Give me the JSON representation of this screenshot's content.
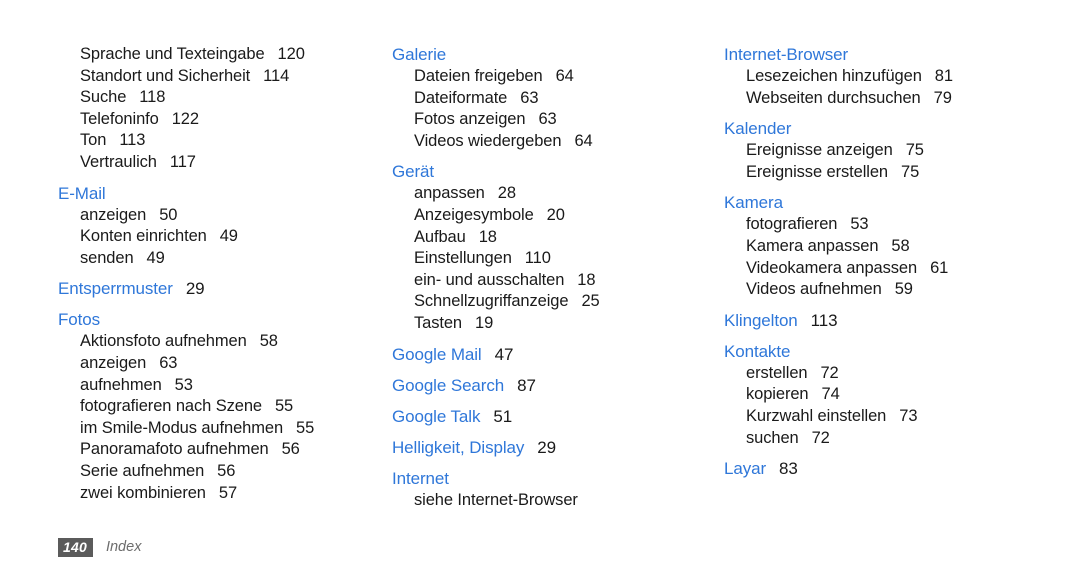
{
  "document": {
    "footer": {
      "page_number": "140",
      "label": "Index"
    },
    "heading_color": "#2F77D9",
    "text_color": "#1A1A1A",
    "badge_color": "#5B5B5B"
  },
  "columns": [
    {
      "id": "column-1",
      "sections": [
        {
          "heading": null,
          "heading_page": null,
          "entries": [
            {
              "label": "Sprache und Texteingabe",
              "page": "120"
            },
            {
              "label": "Standort und Sicherheit",
              "page": "114"
            },
            {
              "label": "Suche",
              "page": "118"
            },
            {
              "label": "Telefoninfo",
              "page": "122"
            },
            {
              "label": "Ton",
              "page": "113"
            },
            {
              "label": "Vertraulich",
              "page": "117"
            }
          ]
        },
        {
          "heading": "E-Mail",
          "heading_page": null,
          "entries": [
            {
              "label": "anzeigen",
              "page": "50"
            },
            {
              "label": "Konten einrichten",
              "page": "49"
            },
            {
              "label": "senden",
              "page": "49"
            }
          ]
        },
        {
          "heading": "Entsperrmuster",
          "heading_page": "29",
          "entries": []
        },
        {
          "heading": "Fotos",
          "heading_page": null,
          "entries": [
            {
              "label": "Aktionsfoto aufnehmen",
              "page": "58"
            },
            {
              "label": "anzeigen",
              "page": "63"
            },
            {
              "label": "aufnehmen",
              "page": "53"
            },
            {
              "label": "fotografieren nach Szene",
              "page": "55"
            },
            {
              "label": "im Smile-Modus aufnehmen",
              "page": "55"
            },
            {
              "label": "Panoramafoto aufnehmen",
              "page": "56"
            },
            {
              "label": "Serie aufnehmen",
              "page": "56"
            },
            {
              "label": "zwei kombinieren",
              "page": "57"
            }
          ]
        }
      ]
    },
    {
      "id": "column-2",
      "sections": [
        {
          "heading": "Galerie",
          "heading_page": null,
          "entries": [
            {
              "label": "Dateien freigeben",
              "page": "64"
            },
            {
              "label": "Dateiformate",
              "page": "63"
            },
            {
              "label": "Fotos anzeigen",
              "page": "63"
            },
            {
              "label": "Videos wiedergeben",
              "page": "64"
            }
          ]
        },
        {
          "heading": "Gerät",
          "heading_page": null,
          "entries": [
            {
              "label": "anpassen",
              "page": "28"
            },
            {
              "label": "Anzeigesymbole",
              "page": "20"
            },
            {
              "label": "Aufbau",
              "page": "18"
            },
            {
              "label": "Einstellungen",
              "page": "110"
            },
            {
              "label": "ein- und ausschalten",
              "page": "18"
            },
            {
              "label": "Schnellzugriffanzeige",
              "page": "25"
            },
            {
              "label": "Tasten",
              "page": "19"
            }
          ]
        },
        {
          "heading": "Google Mail",
          "heading_page": "47",
          "entries": []
        },
        {
          "heading": "Google Search",
          "heading_page": "87",
          "entries": []
        },
        {
          "heading": "Google Talk",
          "heading_page": "51",
          "entries": []
        },
        {
          "heading": "Helligkeit, Display",
          "heading_page": "29",
          "entries": []
        },
        {
          "heading": "Internet",
          "heading_page": null,
          "entries": [
            {
              "label": "siehe Internet-Browser",
              "page": null
            }
          ]
        }
      ]
    },
    {
      "id": "column-3",
      "sections": [
        {
          "heading": "Internet-Browser",
          "heading_page": null,
          "entries": [
            {
              "label": "Lesezeichen hinzufügen",
              "page": "81"
            },
            {
              "label": "Webseiten durchsuchen",
              "page": "79"
            }
          ]
        },
        {
          "heading": "Kalender",
          "heading_page": null,
          "entries": [
            {
              "label": "Ereignisse anzeigen",
              "page": "75"
            },
            {
              "label": "Ereignisse erstellen",
              "page": "75"
            }
          ]
        },
        {
          "heading": "Kamera",
          "heading_page": null,
          "entries": [
            {
              "label": "fotografieren",
              "page": "53"
            },
            {
              "label": "Kamera anpassen",
              "page": "58"
            },
            {
              "label": "Videokamera anpassen",
              "page": "61"
            },
            {
              "label": "Videos aufnehmen",
              "page": "59"
            }
          ]
        },
        {
          "heading": "Klingelton",
          "heading_page": "113",
          "entries": []
        },
        {
          "heading": "Kontakte",
          "heading_page": null,
          "entries": [
            {
              "label": "erstellen",
              "page": "72"
            },
            {
              "label": "kopieren",
              "page": "74"
            },
            {
              "label": "Kurzwahl einstellen",
              "page": "73"
            },
            {
              "label": "suchen",
              "page": "72"
            }
          ]
        },
        {
          "heading": "Layar",
          "heading_page": "83",
          "entries": []
        }
      ]
    }
  ]
}
